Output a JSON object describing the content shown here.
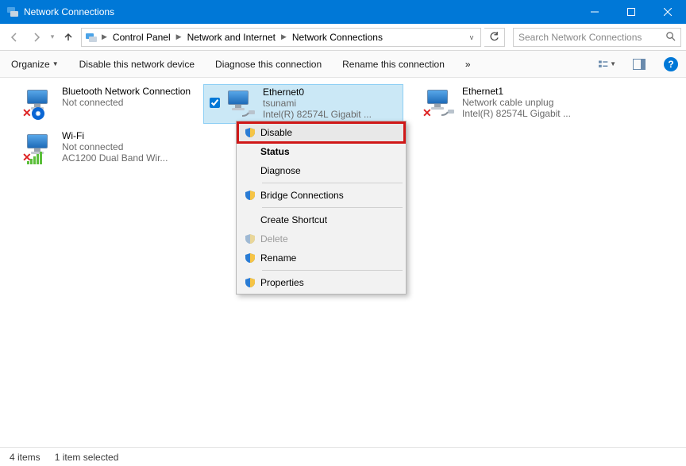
{
  "window": {
    "title": "Network Connections"
  },
  "caption_buttons": {
    "min": "Minimize",
    "max": "Maximize",
    "close": "Close"
  },
  "nav": {
    "back": "Back",
    "forward": "Forward",
    "recent": "Recent locations",
    "up": "Up"
  },
  "breadcrumbs": [
    {
      "label": "Control Panel"
    },
    {
      "label": "Network and Internet"
    },
    {
      "label": "Network Connections"
    }
  ],
  "addr": {
    "dropdown": "Previous locations",
    "refresh": "Refresh"
  },
  "search": {
    "placeholder": "Search Network Connections"
  },
  "commands": {
    "organize": "Organize",
    "disable": "Disable this network device",
    "diagnose": "Diagnose this connection",
    "rename": "Rename this connection",
    "more": "»"
  },
  "header_right": {
    "view_options": "Change your view",
    "preview_pane": "Show the preview pane",
    "help": "?"
  },
  "items": [
    {
      "id": "bluetooth",
      "name": "Bluetooth Network Connection",
      "status": "Not connected",
      "device": "",
      "badge": "bluetooth",
      "error": true
    },
    {
      "id": "ethernet0",
      "name": "Ethernet0",
      "status": "tsunami",
      "device": "Intel(R) 82574L Gigabit ...",
      "badge": "cable",
      "error": false,
      "selected": true
    },
    {
      "id": "ethernet1",
      "name": "Ethernet1",
      "status": "Network cable unplug",
      "device": "Intel(R) 82574L Gigabit ...",
      "badge": "cable",
      "error": true
    },
    {
      "id": "wifi",
      "name": "Wi-Fi",
      "status": "Not connected",
      "device": "AC1200 Dual Band Wir...",
      "badge": "wifi",
      "error": true
    }
  ],
  "context_menu": {
    "disable": {
      "label": "Disable",
      "shield": true,
      "bold": false,
      "disabled": false,
      "highlight": true
    },
    "status": {
      "label": "Status",
      "shield": false,
      "bold": true,
      "disabled": false
    },
    "diagnose": {
      "label": "Diagnose",
      "shield": false,
      "bold": false,
      "disabled": false
    },
    "bridge": {
      "label": "Bridge Connections",
      "shield": true,
      "bold": false,
      "disabled": false
    },
    "shortcut": {
      "label": "Create Shortcut",
      "shield": false,
      "bold": false,
      "disabled": false
    },
    "delete": {
      "label": "Delete",
      "shield": true,
      "bold": false,
      "disabled": true
    },
    "rename": {
      "label": "Rename",
      "shield": true,
      "bold": false,
      "disabled": false
    },
    "props": {
      "label": "Properties",
      "shield": true,
      "bold": false,
      "disabled": false
    }
  },
  "statusbar": {
    "count": "4 items",
    "selected": "1 item selected"
  }
}
